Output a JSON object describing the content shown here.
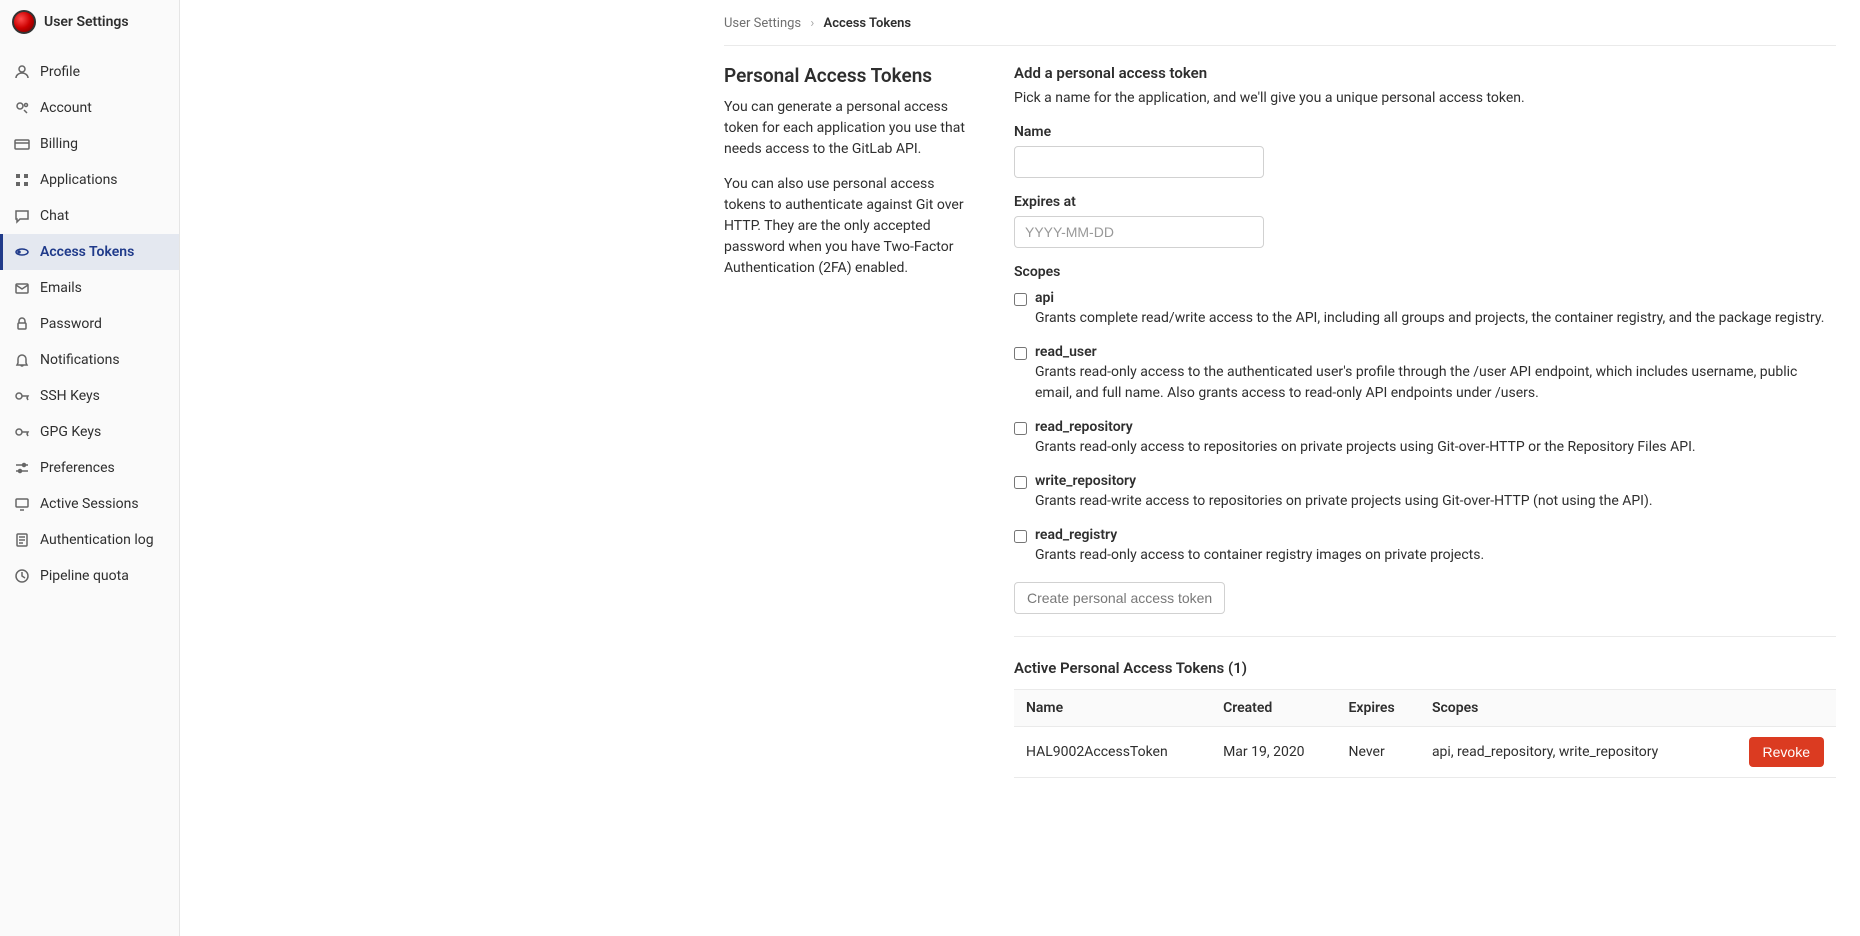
{
  "sidebar": {
    "title": "User Settings",
    "items": [
      {
        "label": "Profile"
      },
      {
        "label": "Account"
      },
      {
        "label": "Billing"
      },
      {
        "label": "Applications"
      },
      {
        "label": "Chat"
      },
      {
        "label": "Access Tokens"
      },
      {
        "label": "Emails"
      },
      {
        "label": "Password"
      },
      {
        "label": "Notifications"
      },
      {
        "label": "SSH Keys"
      },
      {
        "label": "GPG Keys"
      },
      {
        "label": "Preferences"
      },
      {
        "label": "Active Sessions"
      },
      {
        "label": "Authentication log"
      },
      {
        "label": "Pipeline quota"
      }
    ]
  },
  "breadcrumb": {
    "parent": "User Settings",
    "current": "Access Tokens"
  },
  "intro": {
    "title": "Personal Access Tokens",
    "p1": "You can generate a personal access token for each application you use that needs access to the GitLab API.",
    "p2": "You can also use personal access tokens to authenticate against Git over HTTP. They are the only accepted password when you have Two-Factor Authentication (2FA) enabled."
  },
  "form": {
    "header": "Add a personal access token",
    "sub": "Pick a name for the application, and we'll give you a unique personal access token.",
    "name_label": "Name",
    "expires_label": "Expires at",
    "expires_placeholder": "YYYY-MM-DD",
    "scopes_label": "Scopes",
    "scopes": [
      {
        "name": "api",
        "desc": "Grants complete read/write access to the API, including all groups and projects, the container registry, and the package registry."
      },
      {
        "name": "read_user",
        "desc": "Grants read-only access to the authenticated user's profile through the /user API endpoint, which includes username, public email, and full name. Also grants access to read-only API endpoints under /users."
      },
      {
        "name": "read_repository",
        "desc": "Grants read-only access to repositories on private projects using Git-over-HTTP or the Repository Files API."
      },
      {
        "name": "write_repository",
        "desc": "Grants read-write access to repositories on private projects using Git-over-HTTP (not using the API)."
      },
      {
        "name": "read_registry",
        "desc": "Grants read-only access to container registry images on private projects."
      }
    ],
    "create_btn": "Create personal access token"
  },
  "active": {
    "title": "Active Personal Access Tokens (1)",
    "headers": {
      "name": "Name",
      "created": "Created",
      "expires": "Expires",
      "scopes": "Scopes"
    },
    "rows": [
      {
        "name": "HAL9002AccessToken",
        "created": "Mar 19, 2020",
        "expires": "Never",
        "scopes": "api, read_repository, write_repository",
        "revoke": "Revoke"
      }
    ]
  }
}
